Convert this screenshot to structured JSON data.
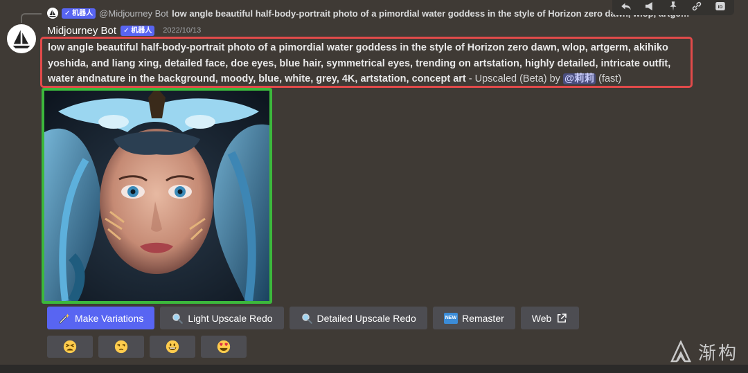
{
  "reply": {
    "author": "@Midjourney Bot",
    "bot_tag": "✓ 机器人",
    "snippet": "low angle beautiful half-body-portrait photo of a pimordial water goddess in the style of Horizon zero dawn, wlop, artgerm, akihiko"
  },
  "message": {
    "username": "Midjourney Bot",
    "bot_tag": "✓ 机器人",
    "timestamp": "2022/10/13",
    "prompt": "low angle beautiful half-body-portrait photo of a pimordial water goddess in the style of Horizon zero dawn, wlop, artgerm, akihiko yoshida, and liang xing, detailed face, doe eyes, blue hair, symmetrical eyes, trending on artstation, highly detailed, intricate outfit, water andnature in the background, moody, blue, white, grey, 4K, artstation, concept art",
    "suffix": " - Upscaled (Beta) by ",
    "mention": "@莉莉",
    "speed": " (fast)"
  },
  "toolbar": {
    "icons": [
      "reply-icon",
      "megaphone-icon",
      "pin-icon",
      "link-icon",
      "id-icon"
    ],
    "id_label": "ID"
  },
  "buttons": {
    "make_variations": "Make Variations",
    "light_upscale_redo": "Light Upscale Redo",
    "detailed_upscale_redo": "Detailed Upscale Redo",
    "remaster": "Remaster",
    "remaster_badge": "NEW",
    "web": "Web"
  },
  "reactions": [
    "tired-face",
    "unamused-face",
    "grinning-face",
    "heart-eyes-face"
  ],
  "watermark": {
    "text": "渐构"
  },
  "colors": {
    "accent": "#5865f2",
    "highlight_red": "#e24a4a",
    "highlight_green": "#3cb83c",
    "background": "#3f3a35"
  }
}
